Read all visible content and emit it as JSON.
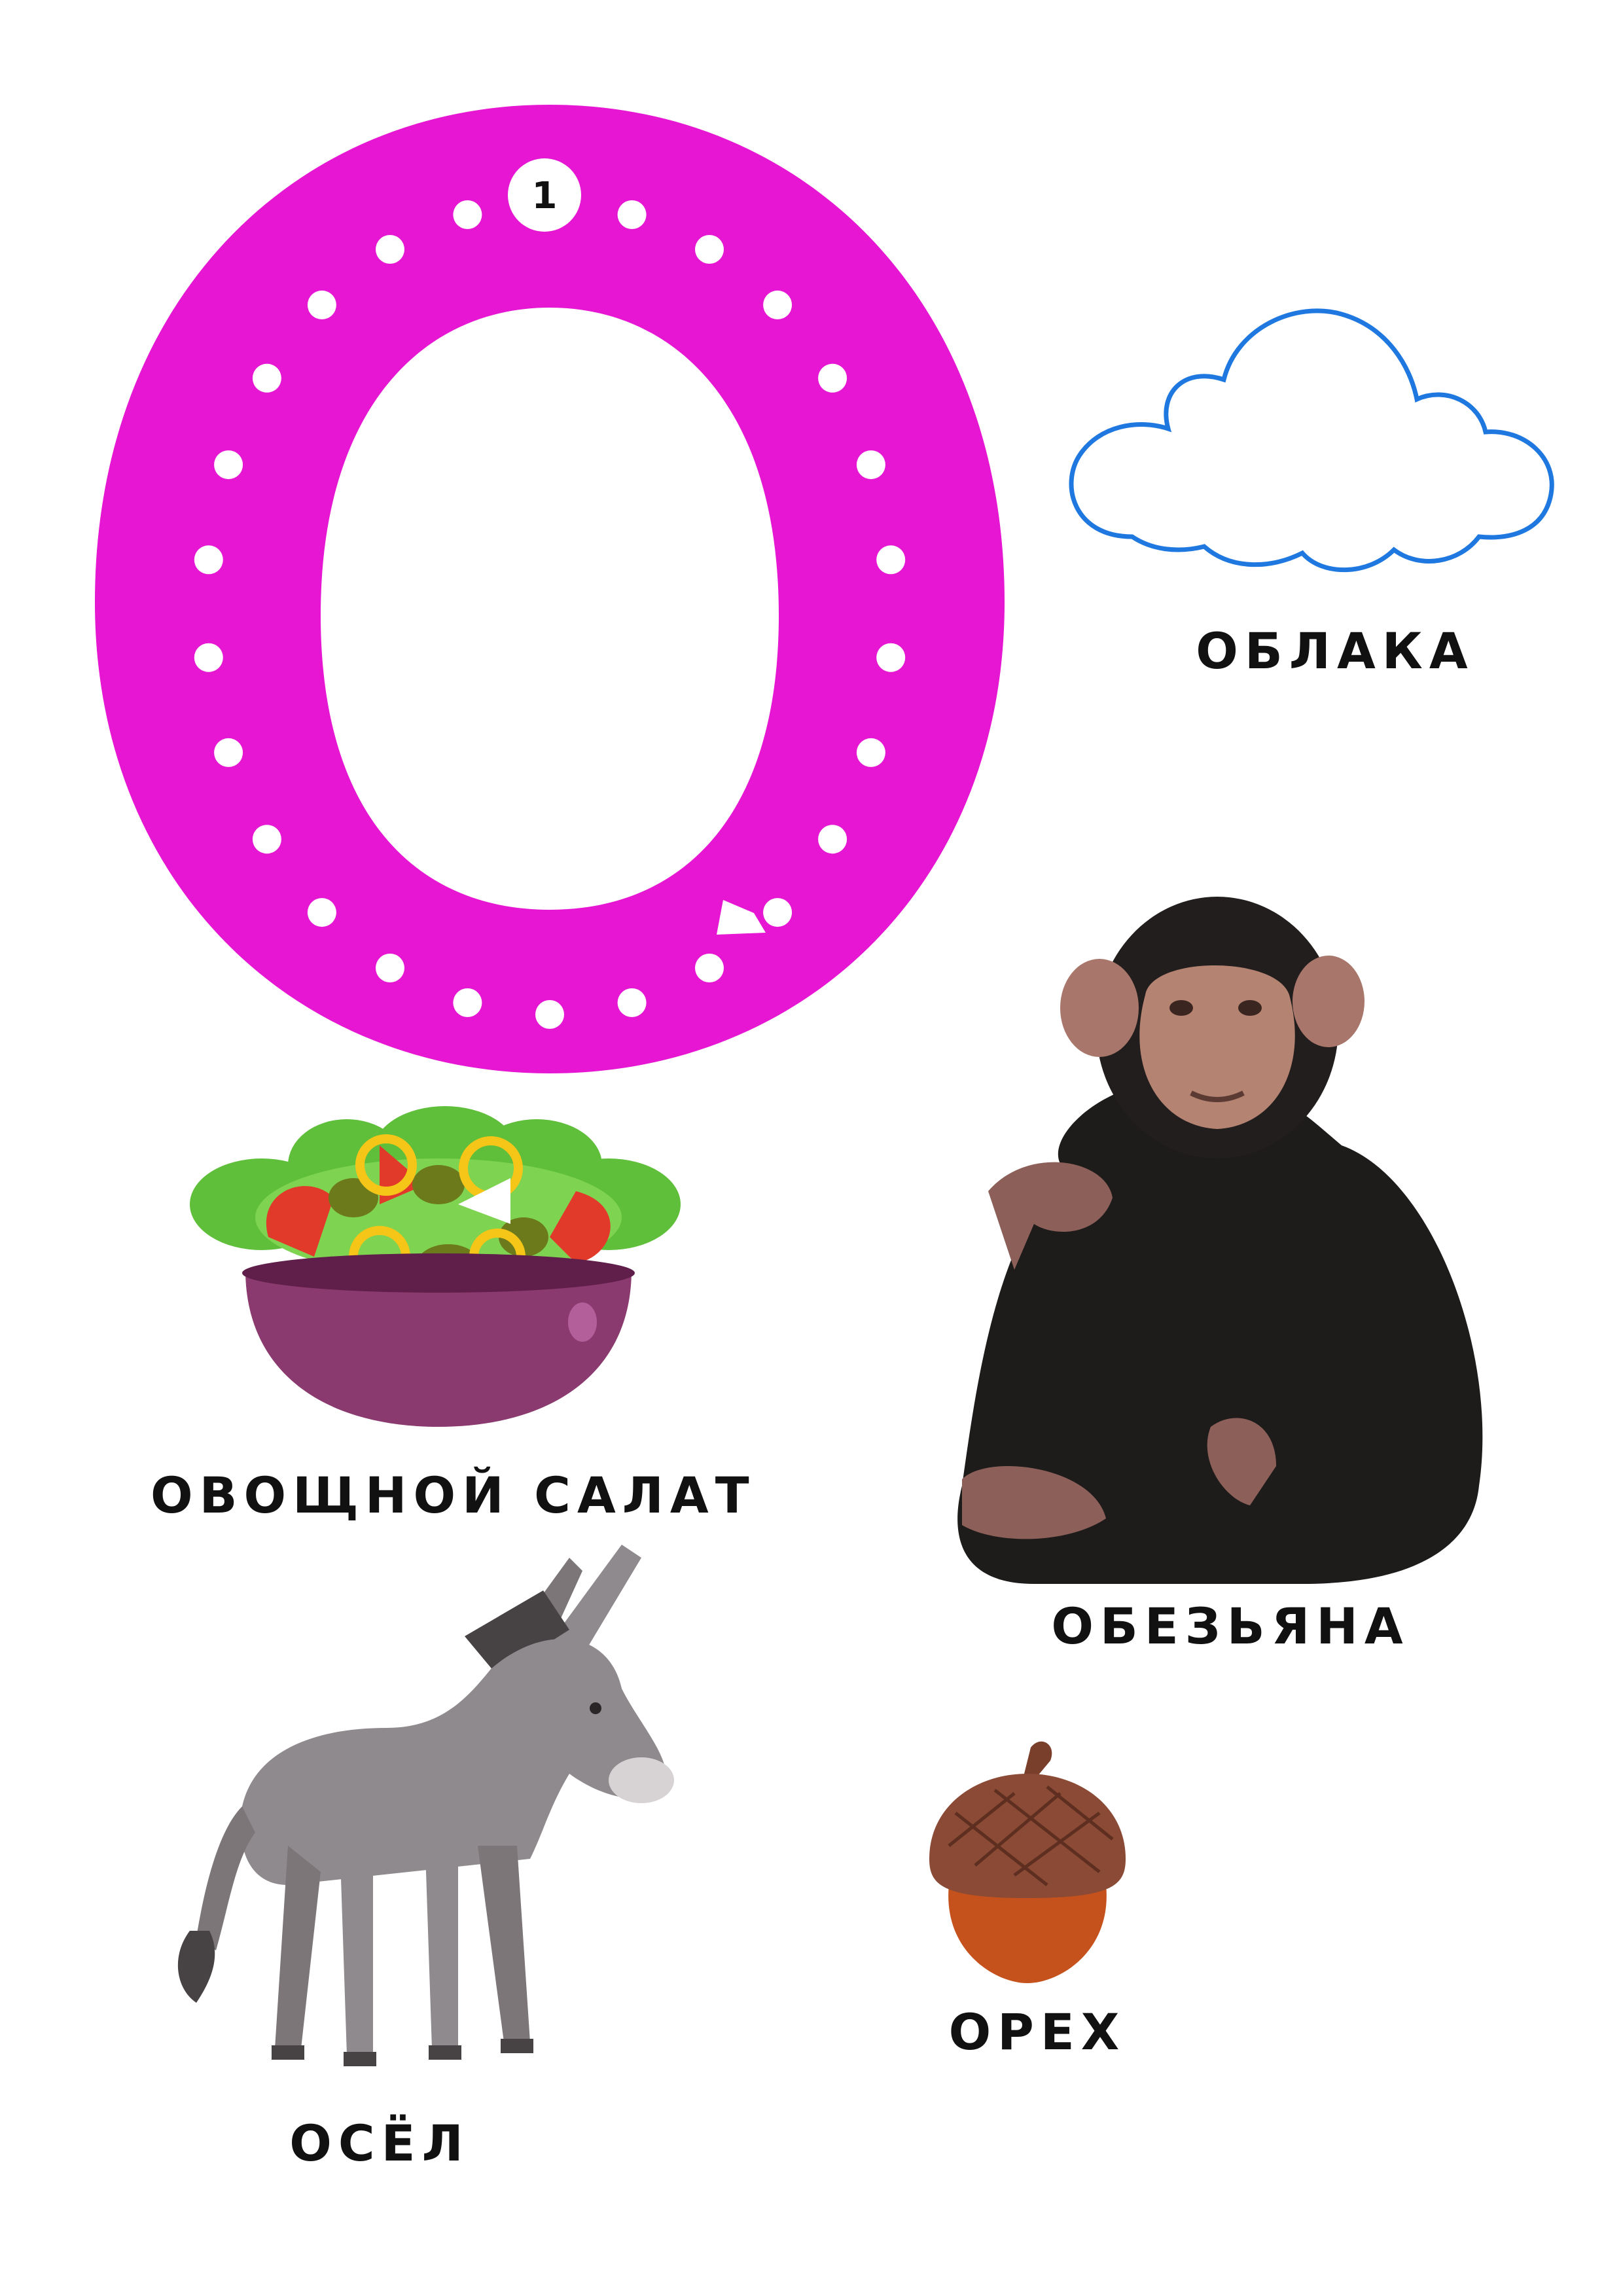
{
  "letter": {
    "glyph": "О",
    "color": "#e616d2",
    "start_marker": "1"
  },
  "items": [
    {
      "id": "cloud",
      "label": "ОБЛАКА",
      "picture": "cloud-outline",
      "outline_color": "#1f78e0"
    },
    {
      "id": "salad",
      "label": "ОВОЩНОЙ САЛАТ",
      "picture": "vegetable-salad-bowl",
      "bowl_color": "#8a3a6e"
    },
    {
      "id": "monkey",
      "label": "ОБЕЗЬЯНА",
      "picture": "chimpanzee"
    },
    {
      "id": "donkey",
      "label": "ОСЁЛ",
      "picture": "donkey",
      "body_color": "#8f8a8d"
    },
    {
      "id": "nut",
      "label": "ОРЕХ",
      "picture": "acorn",
      "nut_color": "#c5521c"
    }
  ]
}
